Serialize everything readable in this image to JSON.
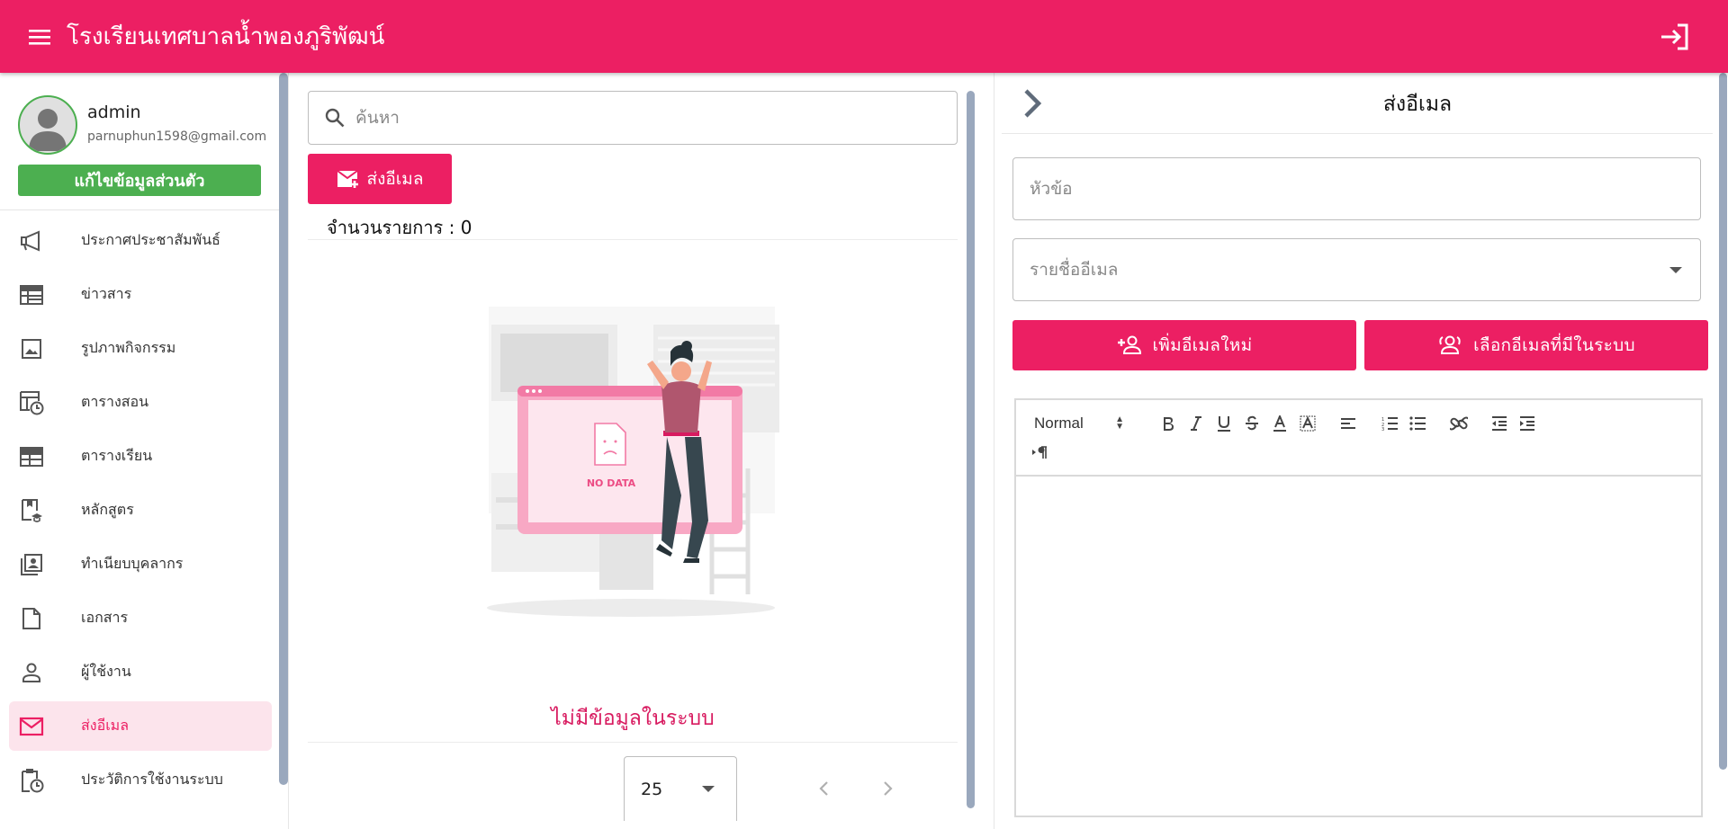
{
  "app": {
    "title": "โรงเรียนเทศบาลน้ำพองภูริพัฒน์"
  },
  "profile": {
    "name": "admin",
    "email": "parnuphun1598@gmail.com",
    "edit_label": "แก้ไขข้อมูลส่วนตัว"
  },
  "sidebar": {
    "items": [
      {
        "label": "ประกาศประชาสัมพันธ์",
        "icon": "megaphone-icon"
      },
      {
        "label": "ข่าวสาร",
        "icon": "newspaper-icon"
      },
      {
        "label": "รูปภาพกิจกรรม",
        "icon": "image-icon"
      },
      {
        "label": "ตารางสอน",
        "icon": "table-clock-icon"
      },
      {
        "label": "ตารางเรียน",
        "icon": "table-icon"
      },
      {
        "label": "หลักสูตร",
        "icon": "book-education-icon"
      },
      {
        "label": "ทำเนียบบุคลากร",
        "icon": "contacts-book-icon"
      },
      {
        "label": "เอกสาร",
        "icon": "document-icon"
      },
      {
        "label": "ผู้ใช้งาน",
        "icon": "user-icon"
      },
      {
        "label": "ส่งอีเมล",
        "icon": "email-icon",
        "active": true
      },
      {
        "label": "ประวัติการใช้งานระบบ",
        "icon": "clipboard-clock-icon"
      }
    ]
  },
  "list": {
    "search_placeholder": "ค้นหา",
    "send_email_label": "ส่งอีเมล",
    "count_label": "จำนวนรายการ : 0",
    "no_data_text": "ไม่มีข้อมูลในระบบ",
    "illustration_caption": "NO DATA",
    "page_size": "25"
  },
  "compose": {
    "title": "ส่งอีเมล",
    "subject_placeholder": "หัวข้อ",
    "email_list_placeholder": "รายชื่ออีเมล",
    "add_email_label": "เพิ่มอีเมลใหม่",
    "choose_email_label": "เลือกอีเมลที่มีในระบบ",
    "editor_format": "Normal"
  },
  "colors": {
    "primary": "#ec1f63",
    "success": "#4caf50",
    "active_bg": "#fce4ec",
    "scrollbar": "#9aa8bd"
  }
}
